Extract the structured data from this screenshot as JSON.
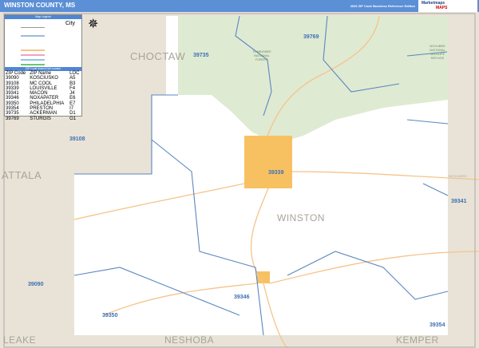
{
  "header": {
    "title": "WINSTON COUNTY, MS",
    "edition": "2026 ZIP Code Business Reference Edition",
    "logo_text": "Marketmaps",
    "logo_brand": "MAPS"
  },
  "legend": {
    "title": "ZIP Code Index/Grid Locator",
    "top_title": "Map Legend",
    "city_label": "City",
    "columns": [
      "ZIP Code",
      "ZIP Name",
      "LOC"
    ],
    "rows": [
      [
        "39090",
        "KOSCIUSKO",
        "A5"
      ],
      [
        "39108",
        "MC COOL",
        "B3"
      ],
      [
        "39339",
        "LOUISVILLE",
        "F4"
      ],
      [
        "39341",
        "MACON",
        "J4"
      ],
      [
        "39346",
        "NOXAPATER",
        "E6"
      ],
      [
        "39350",
        "PHILADELPHIA",
        "E7"
      ],
      [
        "39354",
        "PRESTON",
        "I7"
      ],
      [
        "39735",
        "ACKERMAN",
        "D1"
      ],
      [
        "39769",
        "STURGIS",
        "G1"
      ]
    ]
  },
  "counties": {
    "choctaw": "CHOCTAW",
    "attala": "ATTALA",
    "winston": "WINSTON",
    "leake": "LEAKE",
    "neshoba": "NESHOBA",
    "kemper": "KEMPER",
    "noxubee": "NOXUBEE"
  },
  "zips": {
    "z39769": "39769",
    "z39735": "39735",
    "z39108": "39108",
    "z39339": "39339",
    "z39341": "39341",
    "z39090": "39090",
    "z39350": "39350",
    "z39346": "39346",
    "z39354": "39354"
  },
  "places": {
    "forest": "TOMBIGBEE NATIONAL FOREST",
    "refuge": "NOXUBEE NATIONAL WILDLIFE REFUGE"
  },
  "colors": {
    "header": "#5b8fd6",
    "outside": "#e8e3d6",
    "forest": "#dfead3",
    "city": "#f7c162",
    "zip_line": "#5b86c0",
    "highway": "#f5c48a"
  }
}
